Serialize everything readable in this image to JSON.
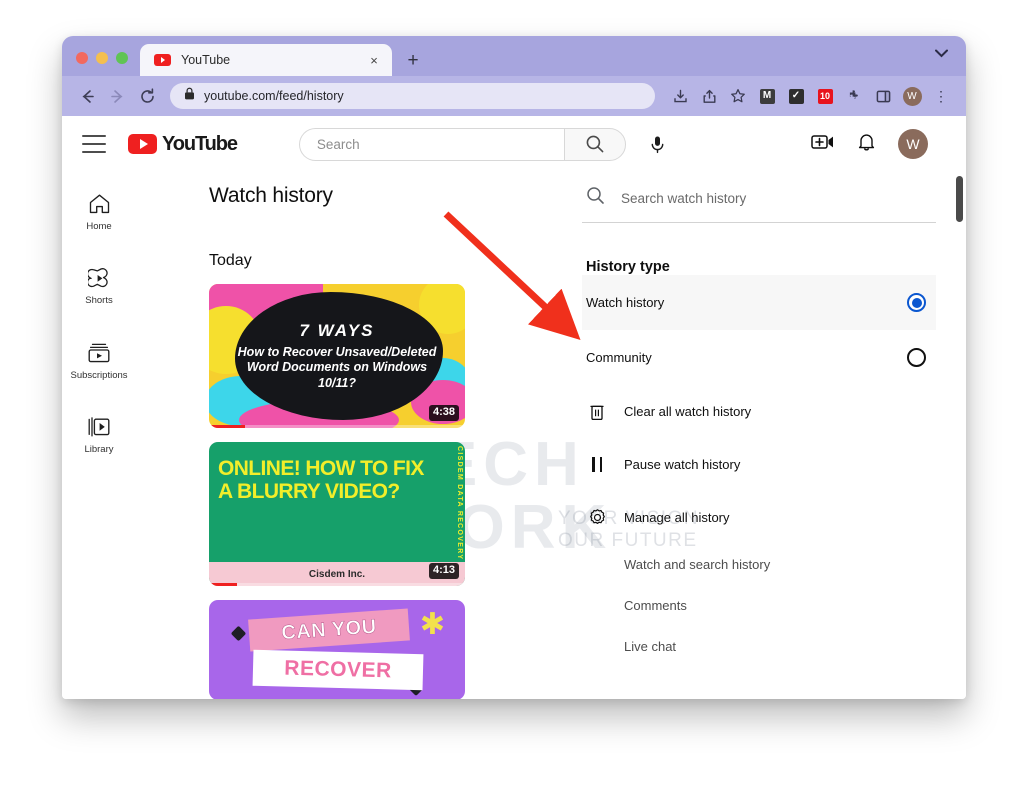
{
  "browser": {
    "tab": {
      "title": "YouTube",
      "favicon": "youtube-icon",
      "close": "×"
    },
    "new_tab_label": "+",
    "tabstrip_chevron": "⌄",
    "url": "youtube.com/feed/history",
    "toolbar_extensions": [
      "M",
      "✓",
      "★"
    ],
    "profile_initial": "W",
    "kebab": "⋮"
  },
  "youtube": {
    "logo_text": "YouTube",
    "search": {
      "placeholder": "Search"
    },
    "sidebar": [
      {
        "label": "Home",
        "icon": "home-icon"
      },
      {
        "label": "Shorts",
        "icon": "shorts-icon"
      },
      {
        "label": "Subscriptions",
        "icon": "subscriptions-icon"
      },
      {
        "label": "Library",
        "icon": "library-icon"
      }
    ],
    "main": {
      "page_title": "Watch history",
      "section_label": "Today",
      "videos": [
        {
          "line1": "7 WAYS",
          "line2": "How to Recover Unsaved/Deleted Word Documents on Windows 10/11?",
          "duration": "4:38",
          "progress_pct": 14
        },
        {
          "title": "ONLINE! HOW TO FIX A BLURRY VIDEO?",
          "side_text": "CISDEM DATA RECOVERY",
          "footer": "Cisdem Inc.",
          "duration": "4:13",
          "progress_pct": 11
        },
        {
          "band1": "CAN YOU",
          "band2": "RECOVER"
        }
      ]
    },
    "panel": {
      "search_placeholder": "Search watch history",
      "history_type_heading": "History type",
      "history_types": [
        {
          "label": "Watch history",
          "selected": true
        },
        {
          "label": "Community",
          "selected": false
        }
      ],
      "actions": [
        {
          "label": "Clear all watch history",
          "icon": "trash-icon"
        },
        {
          "label": "Pause watch history",
          "icon": "pause-icon"
        },
        {
          "label": "Manage all history",
          "icon": "gear-icon"
        }
      ],
      "sub_items": [
        {
          "label": "Watch and search history"
        },
        {
          "label": "Comments"
        },
        {
          "label": "Live chat"
        }
      ]
    }
  },
  "watermark": {
    "line1": "TECH",
    "line2": "WORK",
    "tagline_1": "YOUR VISION",
    "tagline_2": "OUR FUTURE"
  },
  "annotation": {
    "arrow_color": "#f0301c",
    "points_to": "Watch history"
  }
}
